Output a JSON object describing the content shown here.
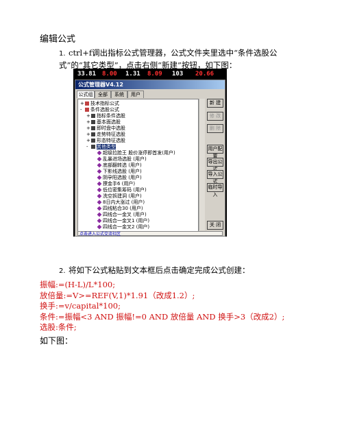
{
  "doc": {
    "heading": "编辑公式",
    "step1_num": "1.",
    "step1_text": "ctrl+f调出指标公式管理器，公式文件夹里选中“条件选股公式”的“其它类型”，点击右侧“新建”按钮，如下图：",
    "step2_num": "2.",
    "step2_text": "将如下公式粘贴到文本框后点击确定完成公式创建：",
    "code_lines": [
      "振幅:=(H-L)/L*100;",
      "放倍量:=V>=REF(V,1)*1.91（改成1.2）;",
      "换手:=v/capital*100;",
      "条件:=振幅<3 AND 振幅!=0 AND 放倍量 AND 换手>3（改成2）;",
      "选股:条件;"
    ],
    "footer": "如下图："
  },
  "screenshot": {
    "ticker": [
      "33.81",
      "8.00",
      "1.31",
      "8.09",
      "103",
      "20.66"
    ],
    "ticker_colors": [
      "#ffffff",
      "#ff3030",
      "#ffffff",
      "#ff3030",
      "#ffffff",
      "#ff3030"
    ],
    "dialog_title": "公式管理器V4.12",
    "tabs": [
      "公式组",
      "全部",
      "系统",
      "用户"
    ],
    "tree": [
      {
        "label": "技术指标公式",
        "depth": 0,
        "kind": "folder",
        "toggle": "+"
      },
      {
        "label": "条件选股公式",
        "depth": 0,
        "kind": "folder",
        "toggle": "-"
      },
      {
        "label": "指标条件选股",
        "depth": 1,
        "kind": "sub",
        "toggle": "+"
      },
      {
        "label": "基本面选股",
        "depth": 1,
        "kind": "sub",
        "toggle": "+"
      },
      {
        "label": "即时盘中选股",
        "depth": 1,
        "kind": "sub",
        "toggle": "+"
      },
      {
        "label": "走势特征选股",
        "depth": 1,
        "kind": "sub",
        "toggle": "+"
      },
      {
        "label": "形态特征选股",
        "depth": 1,
        "kind": "sub",
        "toggle": "+"
      },
      {
        "label": "其他类型",
        "depth": 1,
        "kind": "sub",
        "toggle": "-",
        "selected": true
      },
      {
        "label": "超级拉脸王   股价涨停即首发(用户)",
        "depth": 2,
        "kind": "item"
      },
      {
        "label": "乱暴进场选股   (用户)",
        "depth": 2,
        "kind": "item"
      },
      {
        "label": "底部翻转选   (用户)",
        "depth": 2,
        "kind": "item"
      },
      {
        "label": "下影线选股   (用户)",
        "depth": 2,
        "kind": "item"
      },
      {
        "label": "阴孕阳选股   (用户)",
        "depth": 2,
        "kind": "item"
      },
      {
        "label": "撩金手6   (用户)",
        "depth": 2,
        "kind": "item"
      },
      {
        "label": "低位密集筹码   (用户)",
        "depth": 2,
        "kind": "item"
      },
      {
        "label": "洗空拆建洞   (用户)",
        "depth": 2,
        "kind": "item"
      },
      {
        "label": "8日内大涨过   (用户)",
        "depth": 2,
        "kind": "item"
      },
      {
        "label": "四线粘合30   (用户)",
        "depth": 2,
        "kind": "item"
      },
      {
        "label": "四线合一金叉   (用户)",
        "depth": 2,
        "kind": "item"
      },
      {
        "label": "四线合一金叉1   (用户)",
        "depth": 2,
        "kind": "item"
      },
      {
        "label": "四线合一金叉2   (用户)",
        "depth": 2,
        "kind": "item"
      }
    ],
    "buttons": [
      {
        "label": "新 建",
        "disabled": false
      },
      {
        "label": "修 改",
        "disabled": true
      },
      {
        "label": "删 除",
        "disabled": true
      },
      {
        "label": "用户配置",
        "disabled": false
      },
      {
        "label": "导出公式",
        "disabled": false
      },
      {
        "label": "导入公式",
        "disabled": false
      },
      {
        "label": "临时导入",
        "disabled": false
      },
      {
        "label": "关 闭",
        "disabled": false
      }
    ],
    "status": "点击进入公式交流社区"
  }
}
